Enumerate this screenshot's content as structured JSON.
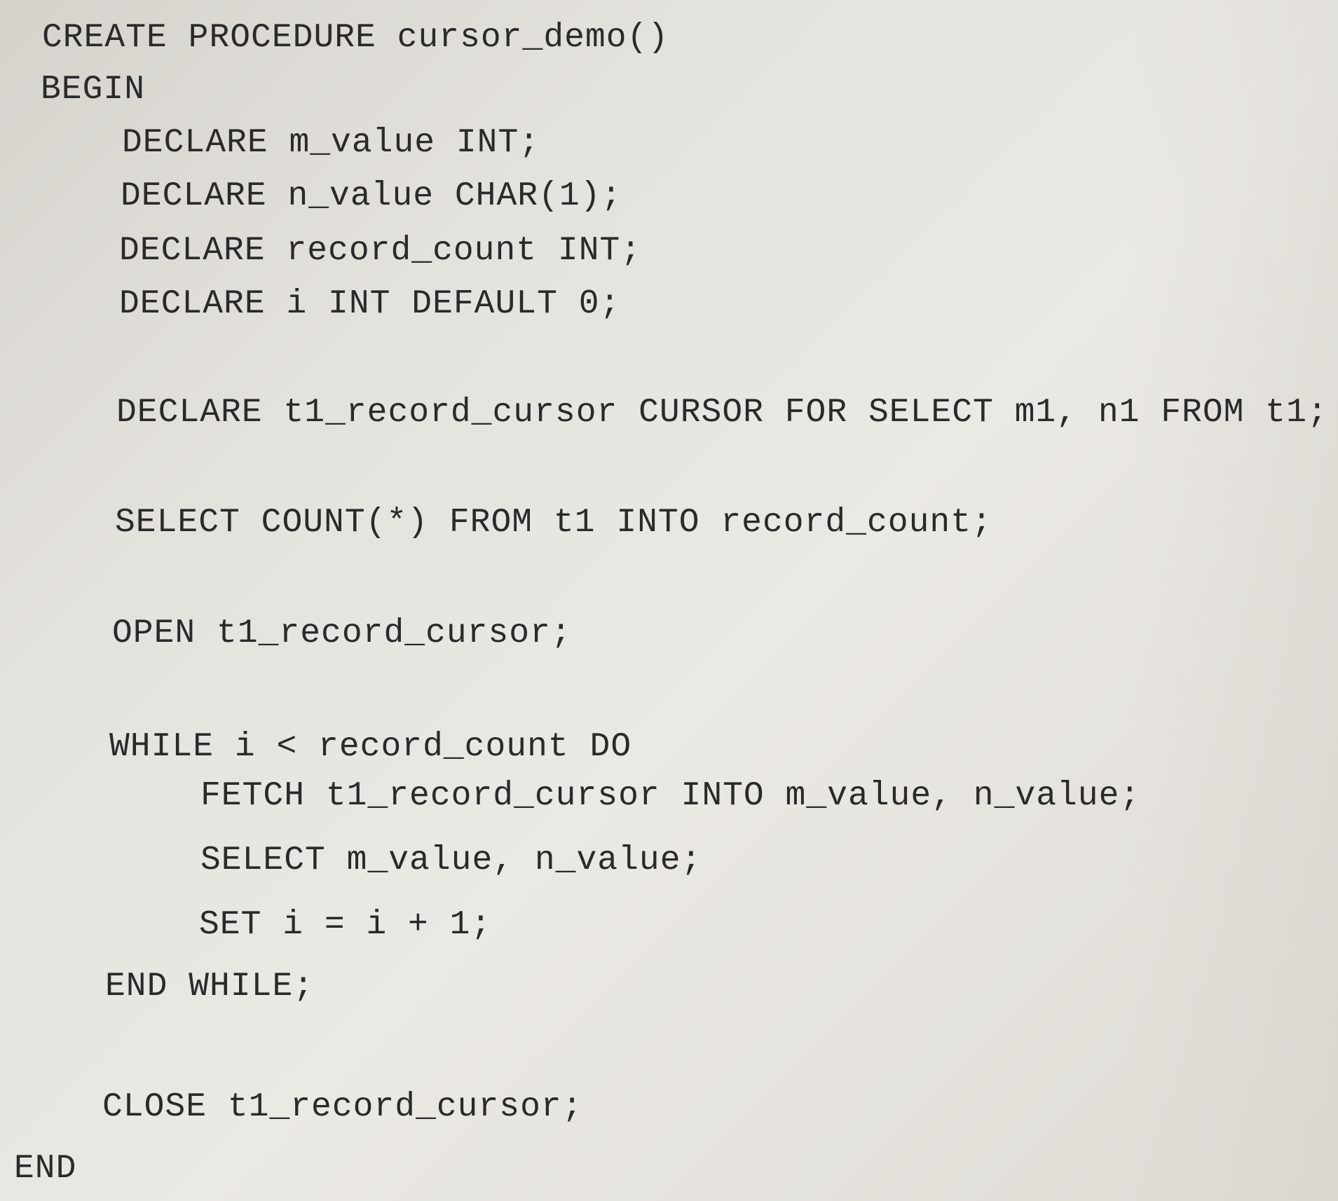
{
  "code": {
    "lines": [
      "CREATE PROCEDURE cursor_demo()",
      "BEGIN",
      "DECLARE m_value INT;",
      "DECLARE n_value CHAR(1);",
      "DECLARE record_count INT;",
      "DECLARE i INT DEFAULT 0;",
      "DECLARE t1_record_cursor CURSOR FOR SELECT m1, n1 FROM t1;",
      "SELECT COUNT(*) FROM t1 INTO record_count;",
      "OPEN t1_record_cursor;",
      "WHILE i < record_count DO",
      "FETCH t1_record_cursor INTO m_value, n_value;",
      "SELECT m_value, n_value;",
      "SET i = i + 1;",
      "END WHILE;",
      "CLOSE t1_record_cursor;",
      "END"
    ]
  }
}
